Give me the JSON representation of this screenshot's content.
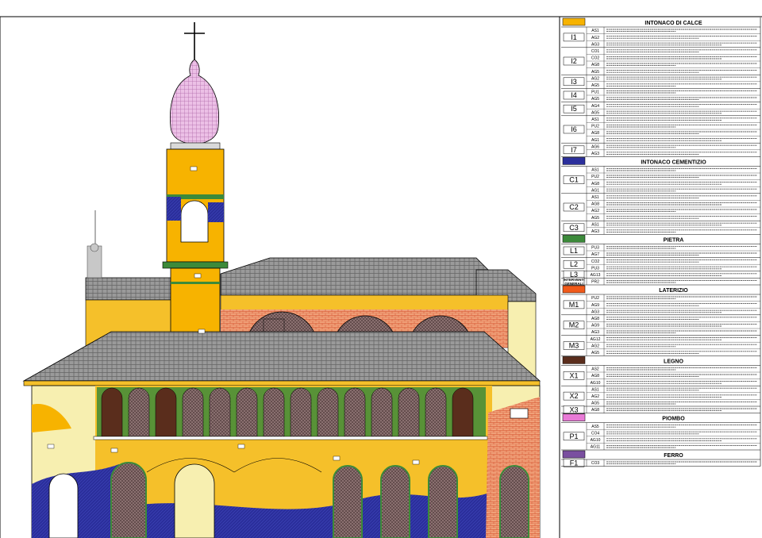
{
  "colors": {
    "calce": "#f7b300",
    "cementizio": "#2b2f9c",
    "pietra": "#3c8a3a",
    "laterizio": "#f05a1a",
    "legno": "#5a2d1c",
    "piombo": "#e87ad6",
    "ferro": "#7a4fa0",
    "ochre": "#f5c02a",
    "pale": "#f7efb0",
    "salmon": "#f09a70",
    "roof": "#8b8b8b",
    "dome": "#e9b8e4"
  },
  "legend": {
    "sections": [
      {
        "title": "INTONACO DI CALCE",
        "swatch_color": "#f7b300",
        "groups": [
          {
            "code": "I1",
            "subs": [
              "AS1",
              "AG2",
              "AG3"
            ]
          },
          {
            "code": "I2",
            "subs": [
              "CO1",
              "CO2",
              "AG8",
              "AG5"
            ]
          },
          {
            "code": "I3",
            "subs": [
              "AG2",
              "AG5"
            ]
          },
          {
            "code": "I4",
            "subs": [
              "PU1",
              "AG5"
            ]
          },
          {
            "code": "I5",
            "subs": [
              "AG4",
              "AG5"
            ]
          },
          {
            "code": "I6",
            "subs": [
              "AS1",
              "PU2",
              "AG8",
              "AG1"
            ]
          },
          {
            "code": "I7",
            "subs": [
              "AG6",
              "AG3"
            ]
          }
        ]
      },
      {
        "title": "INTONACO CEMENTIZIO",
        "swatch_color": "#2b2f9c",
        "groups": [
          {
            "code": "C1",
            "subs": [
              "AS1",
              "PU2",
              "AG8",
              "AG1"
            ]
          },
          {
            "code": "C2",
            "subs": [
              "AS1",
              "AG8",
              "AG2",
              "AG5"
            ]
          },
          {
            "code": "C3",
            "subs": [
              "AS1",
              "AG3"
            ]
          }
        ]
      },
      {
        "title": "PIETRA",
        "swatch_color": "#3c8a3a",
        "groups": [
          {
            "code": "L1",
            "subs": [
              "PU3",
              "AG7"
            ]
          },
          {
            "code": "L2",
            "subs": [
              "CO2",
              "PU3"
            ]
          },
          {
            "code": "L3",
            "subs": [
              "AG13"
            ]
          },
          {
            "code": "INTERVENTI GENERALI",
            "subs": [
              "PR2"
            ]
          }
        ]
      },
      {
        "title": "LATERIZIO",
        "swatch_color": "#f05a1a",
        "groups": [
          {
            "code": "M1",
            "subs": [
              "PU2",
              "AG9",
              "AG3"
            ]
          },
          {
            "code": "M2",
            "subs": [
              "AG8",
              "AG9",
              "AG3"
            ]
          },
          {
            "code": "M3",
            "subs": [
              "AG12",
              "AG2",
              "AG5"
            ]
          }
        ]
      },
      {
        "title": "LEGNO",
        "swatch_color": "#5a2d1c",
        "groups": [
          {
            "code": "X1",
            "subs": [
              "AS2",
              "AG8",
              "AG10"
            ]
          },
          {
            "code": "X2",
            "subs": [
              "AS1",
              "AG2",
              "AG5"
            ]
          },
          {
            "code": "X3",
            "subs": [
              "AG8"
            ]
          }
        ]
      },
      {
        "title": "PIOMBO",
        "swatch_color": "#e87ad6",
        "groups": [
          {
            "code": "P1",
            "subs": [
              "AS5",
              "CO4",
              "AG10",
              "AG11"
            ]
          }
        ]
      },
      {
        "title": "FERRO",
        "swatch_color": "#7a4fa0",
        "groups": [
          {
            "code": "F1",
            "subs": [
              "CO3"
            ]
          }
        ]
      }
    ]
  }
}
